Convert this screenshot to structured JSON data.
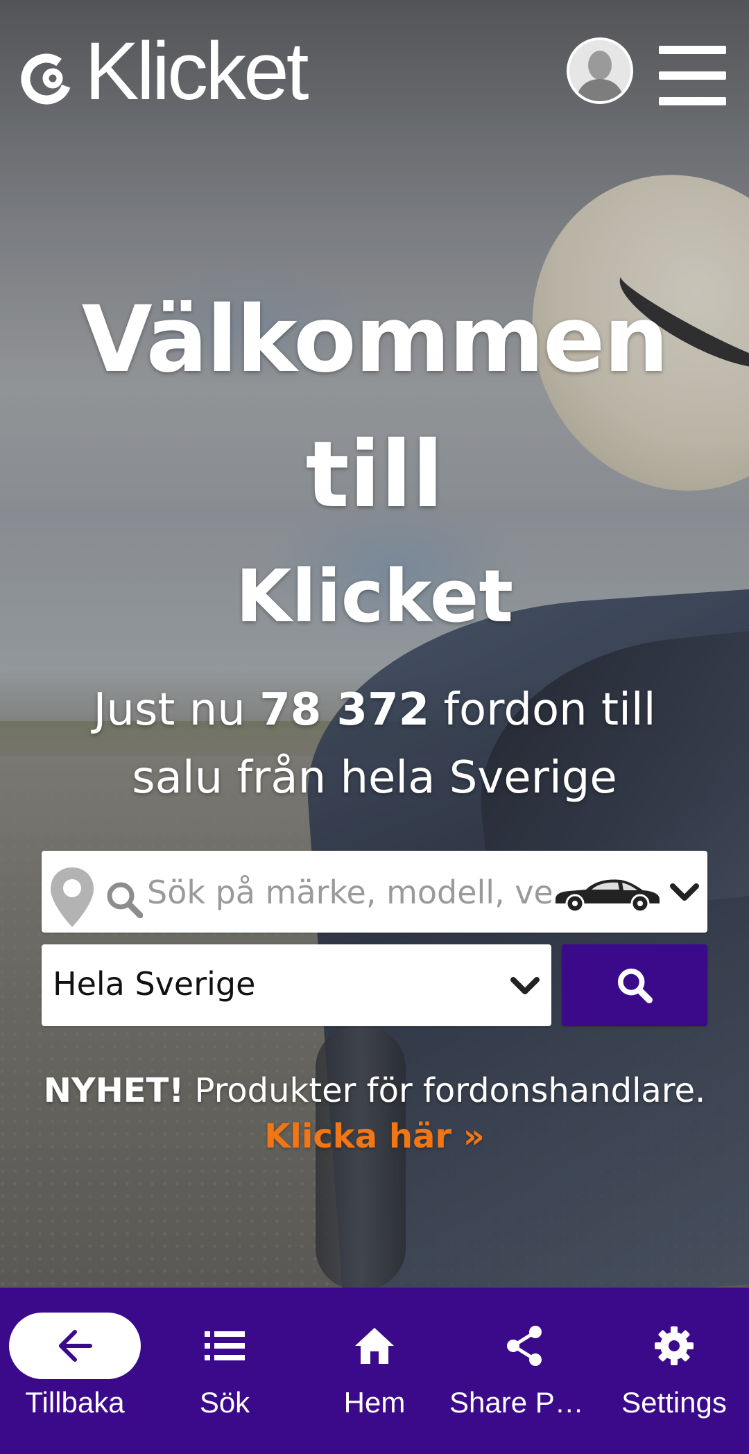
{
  "header": {
    "logo_text": "Klicket",
    "avatar_icon": "user-avatar-icon",
    "menu_icon": "hamburger-menu-icon"
  },
  "hero": {
    "title_line1": "Välkommen",
    "title_line2": "till",
    "title_line3": "Klicket",
    "tagline_prefix": "Just nu ",
    "vehicle_count": "78 372",
    "tagline_suffix": " fordon till salu från hela Sverige"
  },
  "search": {
    "placeholder": "Sök på märke, modell, ver",
    "location_icon": "map-pin-icon",
    "search_icon": "search-icon",
    "vehicle_type_icon": "car-icon",
    "region_value": "Hela Sverige"
  },
  "news": {
    "badge": "NYHET!",
    "text": " Produkter för fordonshandlare.",
    "link": "Klicka här »"
  },
  "bottom_nav": {
    "items": [
      {
        "label": "Tillbaka",
        "icon": "arrow-left-icon"
      },
      {
        "label": "Sök",
        "icon": "list-icon"
      },
      {
        "label": "Hem",
        "icon": "home-icon"
      },
      {
        "label": "Share Pa…",
        "icon": "share-icon"
      },
      {
        "label": "Settings",
        "icon": "gear-icon"
      }
    ]
  },
  "colors": {
    "brand_purple": "#3a0a8a",
    "link_orange": "#f27613",
    "text_white": "#ffffff"
  }
}
